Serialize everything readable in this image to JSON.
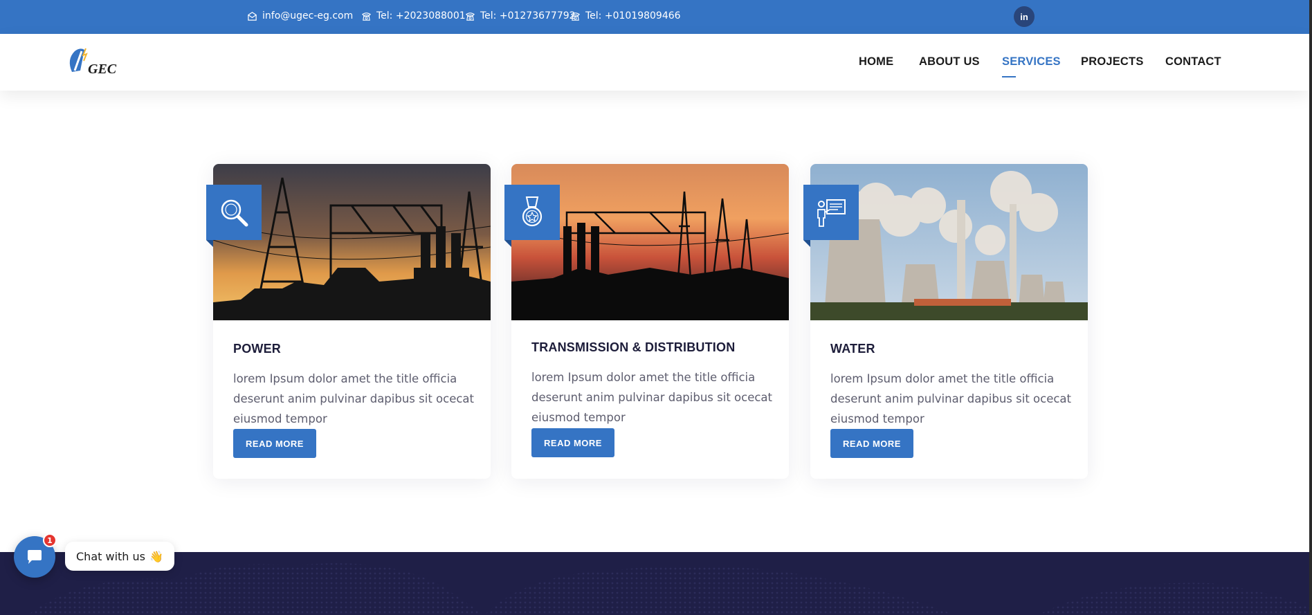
{
  "topbar": {
    "email": "info@ugec-eg.com",
    "phone1": "Tel: +2023088001",
    "phone2": "Tel: +01273677792",
    "phone3": "Tel: +01019809466",
    "social_label": "in"
  },
  "header": {
    "logo_text": "GEC",
    "nav": {
      "home": "HOME",
      "about": "ABOUT US",
      "services": "SERVICES",
      "projects": "PROJECTS",
      "contact": "CONTACT"
    },
    "active_nav": "SERVICES"
  },
  "cards": [
    {
      "icon": "magnifier-icon",
      "title": "POWER",
      "text": "lorem Ipsum dolor amet the title officia deserunt anim pulvinar dapibus sit ocecat eiusmod tempor",
      "button": "READ MORE"
    },
    {
      "icon": "medal-icon",
      "title": "TRANSMISSION & DISTRIBUTION",
      "text": "lorem Ipsum dolor amet the title officia deserunt anim pulvinar dapibus sit ocecat eiusmod tempor",
      "button": "READ MORE"
    },
    {
      "icon": "presenter-icon",
      "title": "WATER",
      "text": "lorem Ipsum dolor amet the title officia deserunt anim pulvinar dapibus sit ocecat eiusmod tempor",
      "button": "READ MORE"
    }
  ],
  "chat": {
    "label": "Chat with us",
    "emoji": "👋",
    "count": "1"
  },
  "colors": {
    "primary": "#3574c4",
    "dark_navy": "#1f1f47",
    "heading": "#1d1d3a"
  }
}
